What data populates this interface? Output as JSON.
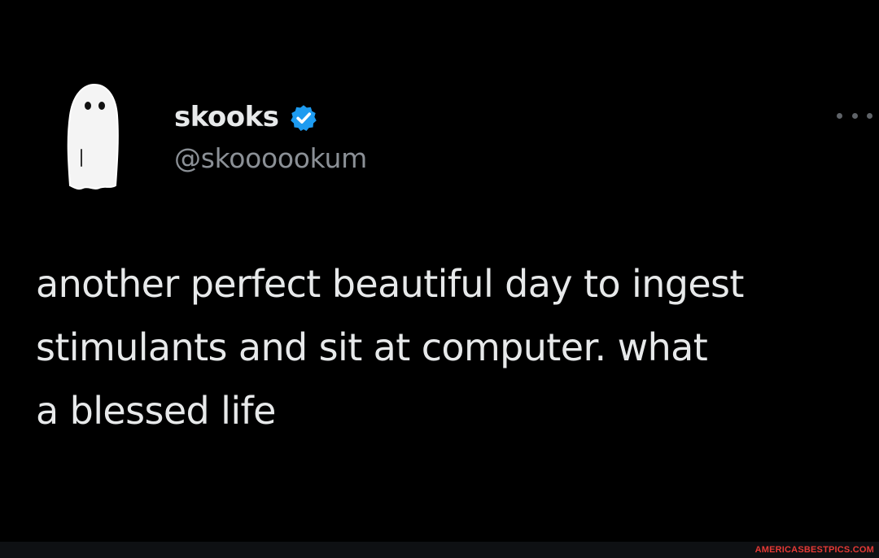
{
  "tweet": {
    "author": {
      "display_name": "skooks",
      "handle": "@skoooookum",
      "verified": true,
      "avatar_icon": "ghost-icon",
      "verified_icon": "verified-badge-icon"
    },
    "more_icon": "more-options-icon",
    "text": "another perfect beautiful day to ingest\nstimulants and sit at computer. what\na blessed life"
  },
  "watermark": {
    "text": "AMERICASBESTPICS.COM"
  },
  "colors": {
    "background": "#000000",
    "text_primary": "#e7e9ea",
    "text_secondary": "#8b9096",
    "verified_blue": "#1d9bf0",
    "watermark_red": "#e53935"
  }
}
